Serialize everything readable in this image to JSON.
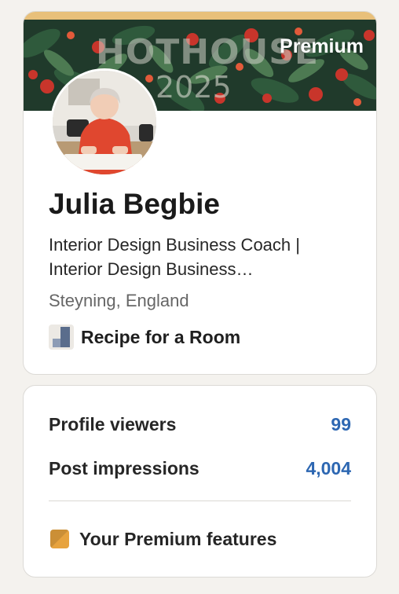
{
  "colors": {
    "premium_gold": "#e7a33e",
    "premium_strip": "#e8c07a",
    "link_blue": "#2d67b2",
    "page_bg": "#f4f2ee"
  },
  "profile": {
    "banner_title": "HOTHOUSE",
    "banner_year": "2025",
    "premium_label": "Premium",
    "name": "Julia Begbie",
    "headline_line1": "Interior Design Business Coach |",
    "headline_line2": "Interior Design Business…",
    "location": "Steyning, England",
    "company_name": "Recipe for a Room",
    "company_logo_icon": "company-logo-icon"
  },
  "stats": {
    "profile_viewers_label": "Profile viewers",
    "profile_viewers_value": "99",
    "post_impressions_label": "Post impressions",
    "post_impressions_value": "4,004",
    "premium_features_label": "Your Premium features",
    "premium_features_icon": "premium-badge-icon"
  }
}
